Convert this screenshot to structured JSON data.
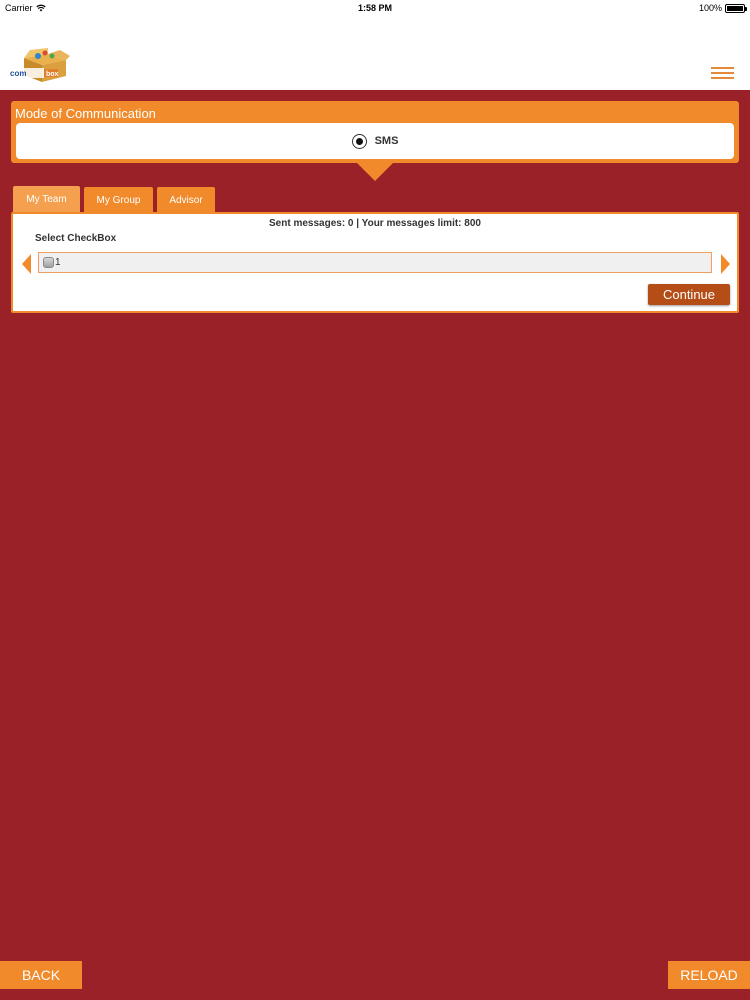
{
  "status_bar": {
    "carrier": "Carrier",
    "time": "1:58 PM",
    "battery": "100%"
  },
  "header": {
    "logo_icon": "combox-logo-icon",
    "menu_icon": "hamburger-menu-icon"
  },
  "mode": {
    "title": "Mode of Communication",
    "option_label": "SMS",
    "selected": true
  },
  "tabs": [
    {
      "label": "My Team",
      "active": true
    },
    {
      "label": "My Group",
      "active": false
    },
    {
      "label": "Advisor",
      "active": false
    }
  ],
  "content": {
    "sent_info": "Sent messages: 0 | Your messages limit: 800",
    "select_label": "Select CheckBox",
    "checkbox_label": "1",
    "continue_label": "Continue"
  },
  "footer": {
    "back_label": "BACK",
    "reload_label": "RELOAD"
  },
  "colors": {
    "background": "#9b2128",
    "accent": "#f18a2a",
    "button_dark": "#b54d17"
  }
}
